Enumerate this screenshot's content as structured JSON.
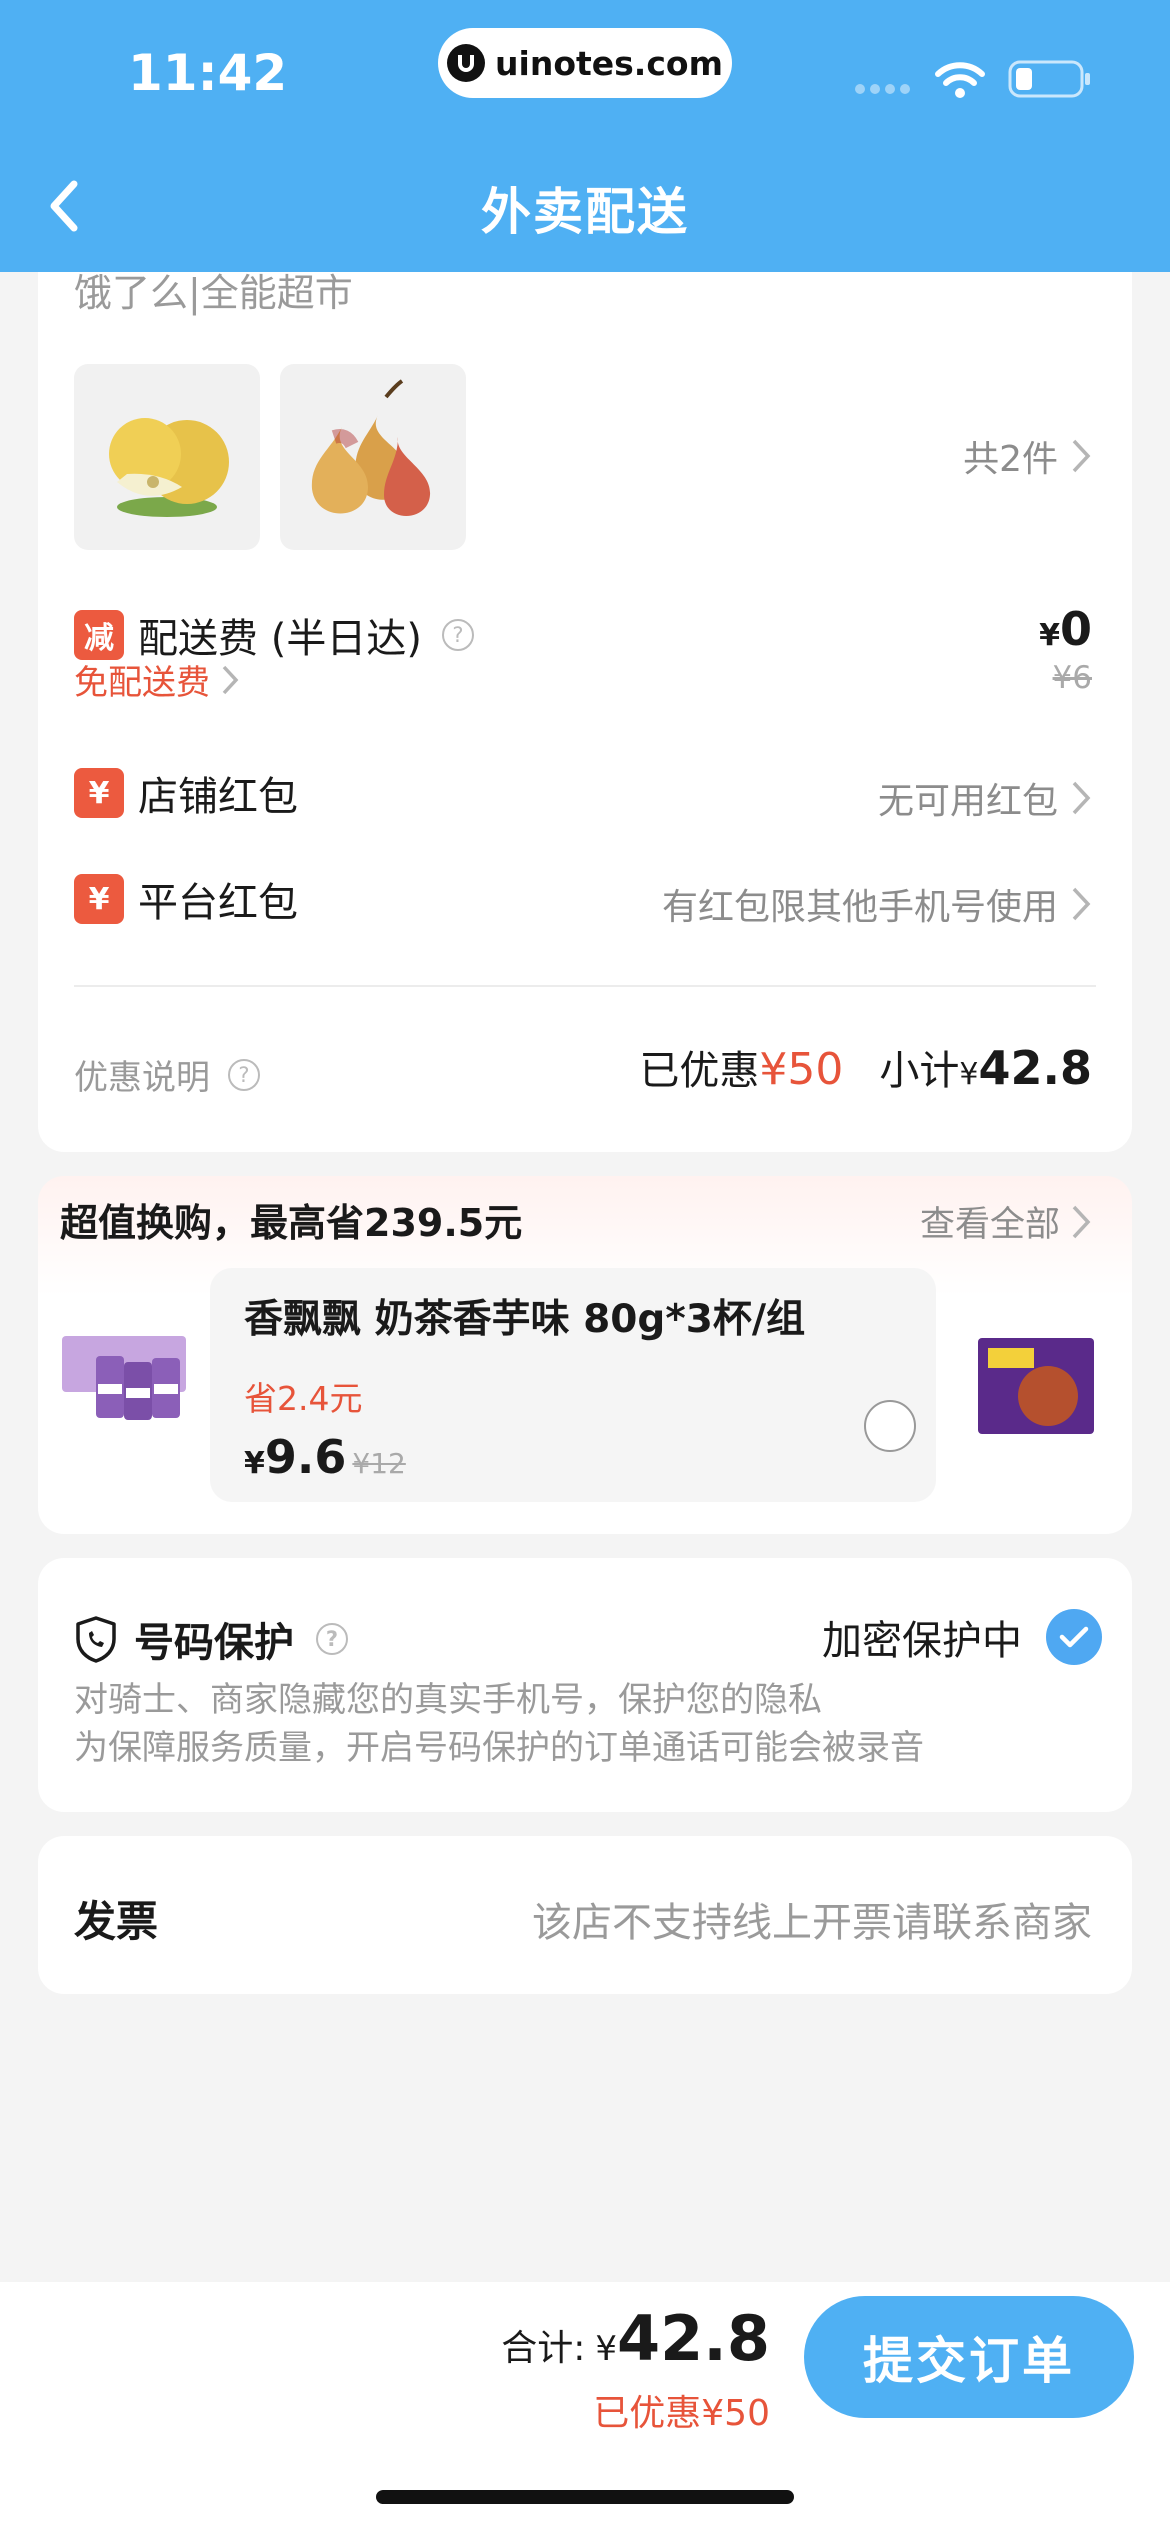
{
  "status_bar": {
    "time": "11:42",
    "url": "uinotes.com"
  },
  "header": {
    "title": "外卖配送"
  },
  "store": {
    "name": "饿了么|全能超市",
    "item_count": "共2件",
    "products": [
      {
        "name": "pear-nashi"
      },
      {
        "name": "pear-red"
      }
    ]
  },
  "delivery": {
    "badge": "减",
    "label": "配送费 (半日达)",
    "help": "?",
    "free_text": "免配送费",
    "price_currency": "¥",
    "price": "0",
    "original_price": "¥6"
  },
  "store_coupon": {
    "badge": "¥",
    "label": "店铺红包",
    "value": "无可用红包"
  },
  "platform_coupon": {
    "badge": "¥",
    "label": "平台红包",
    "value": "有红包限其他手机号使用"
  },
  "discount_summary": {
    "note_label": "优惠说明",
    "help": "?",
    "saved_label": "已优惠",
    "saved_amount": "¥50",
    "subtotal_label": "小计",
    "subtotal_currency": "¥",
    "subtotal_amount": "42.8"
  },
  "exchange": {
    "title": "超值换购，最高省239.5元",
    "view_all": "查看全部",
    "item": {
      "name": "香飘飘 奶茶香芋味 80g*3杯/组",
      "save": "省2.4元",
      "currency": "¥",
      "price": "9.6",
      "original_price": "¥12",
      "selected": false
    }
  },
  "number_protection": {
    "title": "号码保护",
    "help": "?",
    "status": "加密保护中",
    "enabled": true,
    "desc_line1": "对骑士、商家隐藏您的真实手机号，保护您的隐私",
    "desc_line2": "为保障服务质量，开启号码保护的订单通话可能会被录音"
  },
  "invoice": {
    "label": "发票",
    "value": "该店不支持线上开票请联系商家"
  },
  "footer": {
    "total_label": "合计:",
    "total_currency": "¥",
    "total_amount": "42.8",
    "saved_text": "已优惠¥50",
    "submit_label": "提交订单"
  },
  "colors": {
    "primary": "#4fb0f3",
    "accent_red": "#e7543a",
    "check_blue": "#4fa8f2"
  }
}
